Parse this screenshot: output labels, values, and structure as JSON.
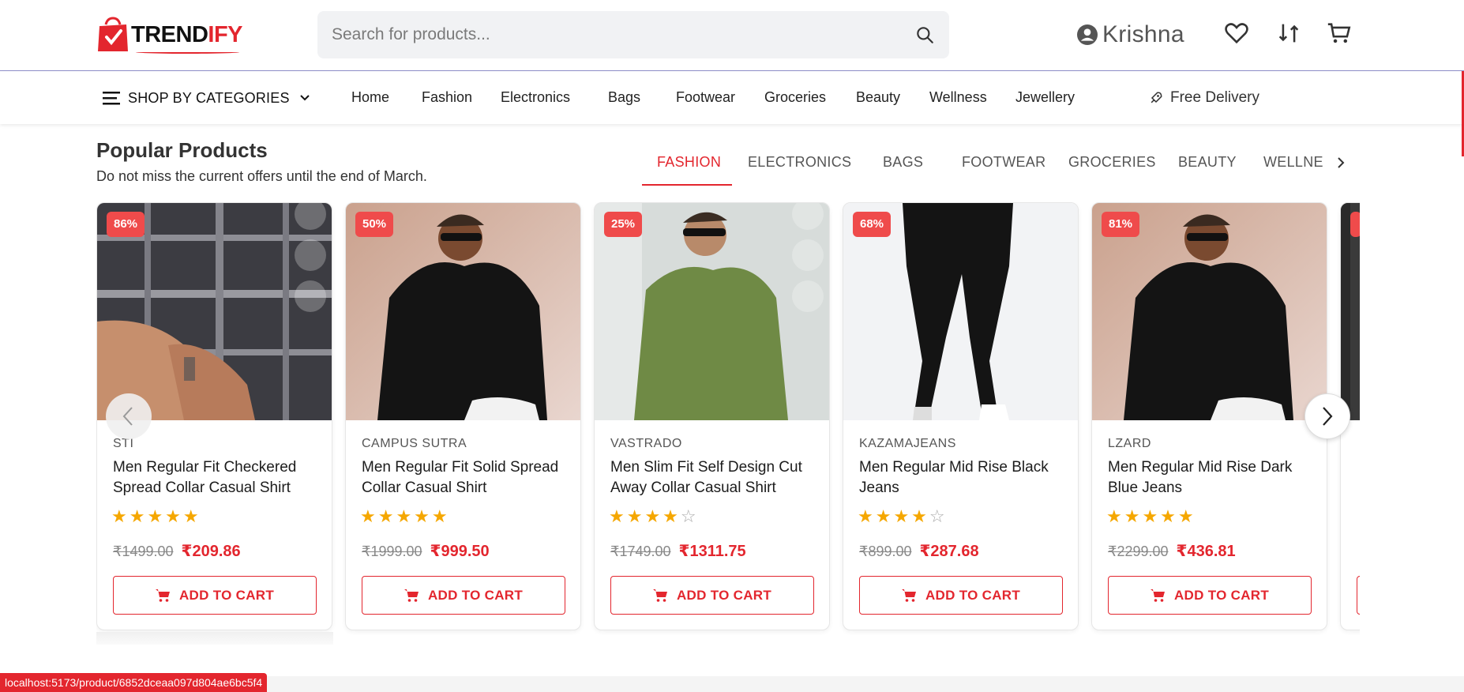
{
  "brand": {
    "name_prefix": "TREND",
    "name_suffix": "IFY"
  },
  "search": {
    "placeholder": "Search for products..."
  },
  "user": {
    "name": "Krishna"
  },
  "nav": {
    "shop_by_categories": "SHOP BY CATEGORIES",
    "links": [
      "Home",
      "Fashion",
      "Electronics",
      "Bags",
      "Footwear",
      "Groceries",
      "Beauty",
      "Wellness",
      "Jewellery"
    ],
    "free_delivery": "Free Delivery"
  },
  "section": {
    "title": "Popular Products",
    "subtitle": "Do not miss the current offers until the end of March.",
    "tabs": [
      "FASHION",
      "ELECTRONICS",
      "BAGS",
      "FOOTWEAR",
      "GROCERIES",
      "BEAUTY",
      "WELLNE"
    ],
    "active_tab": "FASHION"
  },
  "products": [
    {
      "discount": "86%",
      "brand": "STI",
      "name": "Men Regular Fit Checkered Spread Collar Casual Shirt",
      "rating": 5,
      "old_price": "₹1499.00",
      "new_price": "₹209.86",
      "cta": "ADD TO CART"
    },
    {
      "discount": "50%",
      "brand": "CAMPUS SUTRA",
      "name": "Men Regular Fit Solid Spread Collar Casual Shirt",
      "rating": 5,
      "old_price": "₹1999.00",
      "new_price": "₹999.50",
      "cta": "ADD TO CART"
    },
    {
      "discount": "25%",
      "brand": "VASTRADO",
      "name": "Men Slim Fit Self Design Cut Away Collar Casual Shirt",
      "rating": 4,
      "old_price": "₹1749.00",
      "new_price": "₹1311.75",
      "cta": "ADD TO CART"
    },
    {
      "discount": "68%",
      "brand": "KAZAMAJEANS",
      "name": "Men Regular Mid Rise Black Jeans",
      "rating": 4,
      "old_price": "₹899.00",
      "new_price": "₹287.68",
      "cta": "ADD TO CART"
    },
    {
      "discount": "81%",
      "brand": "LZARD",
      "name": "Men Regular Mid Rise Dark Blue Jeans",
      "rating": 5,
      "old_price": "₹2299.00",
      "new_price": "₹436.81",
      "cta": "ADD TO CART"
    }
  ],
  "status_url": "localhost:5173/product/6852dceaa097d804ae6bc5f4",
  "colors": {
    "accent": "#e3262e",
    "badge": "#ef4b4b",
    "star": "#f5a700"
  }
}
